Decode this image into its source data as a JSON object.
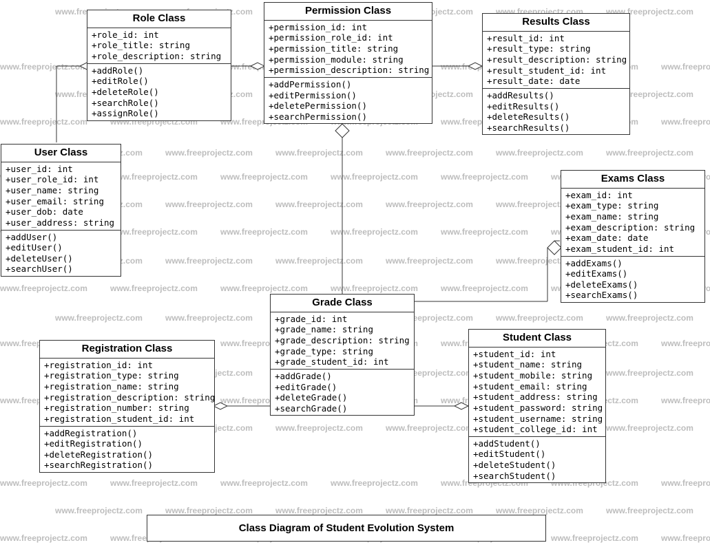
{
  "watermark": "www.freeprojectz.com",
  "caption": "Class Diagram of Student Evolution System",
  "classes": {
    "role": {
      "title": "Role Class",
      "attrs": [
        "+role_id: int",
        "+role_title: string",
        "+role_description: string"
      ],
      "ops": [
        "+addRole()",
        "+editRole()",
        "+deleteRole()",
        "+searchRole()",
        "+assignRole()"
      ]
    },
    "permission": {
      "title": "Permission Class",
      "attrs": [
        "+permission_id: int",
        "+permission_role_id: int",
        "+permission_title: string",
        "+permission_module: string",
        "+permission_description: string"
      ],
      "ops": [
        "+addPermission()",
        "+editPermission()",
        "+deletePermission()",
        "+searchPermission()"
      ]
    },
    "results": {
      "title": "Results Class",
      "attrs": [
        "+result_id: int",
        "+result_type: string",
        "+result_description: string",
        "+result_student_id: int",
        "+result_date: date"
      ],
      "ops": [
        "+addResults()",
        "+editResults()",
        "+deleteResults()",
        "+searchResults()"
      ]
    },
    "user": {
      "title": "User Class",
      "attrs": [
        "+user_id: int",
        "+user_role_id: int",
        "+user_name: string",
        "+user_email: string",
        "+user_dob: date",
        "+user_address: string"
      ],
      "ops": [
        "+addUser()",
        "+editUser()",
        "+deleteUser()",
        "+searchUser()"
      ]
    },
    "exams": {
      "title": "Exams Class",
      "attrs": [
        "+exam_id: int",
        "+exam_type: string",
        "+exam_name: string",
        "+exam_description: string",
        "+exam_date: date",
        "+exam_student_id: int"
      ],
      "ops": [
        "+addExams()",
        "+editExams()",
        "+deleteExams()",
        "+searchExams()"
      ]
    },
    "grade": {
      "title": "Grade Class",
      "attrs": [
        "+grade_id: int",
        "+grade_name: string",
        "+grade_description: string",
        "+grade_type: string",
        "+grade_student_id: int"
      ],
      "ops": [
        "+addGrade()",
        "+editGrade()",
        "+deleteGrade()",
        "+searchGrade()"
      ]
    },
    "student": {
      "title": "Student Class",
      "attrs": [
        "+student_id: int",
        "+student_name: string",
        "+student_mobile: string",
        "+student_email: string",
        "+student_address: string",
        "+student_password: string",
        "+student_username: string",
        "+student_college_id: int"
      ],
      "ops": [
        "+addStudent()",
        "+editStudent()",
        "+deleteStudent()",
        "+searchStudent()"
      ]
    },
    "registration": {
      "title": "Registration Class",
      "attrs": [
        "+registration_id: int",
        "+registration_type: string",
        "+registration_name: string",
        "+registration_description: string",
        "+registration_number: string",
        "+registration_student_id: int"
      ],
      "ops": [
        "+addRegistration()",
        "+editRegistration()",
        "+deleteRegistration()",
        "+searchRegistration()"
      ]
    }
  }
}
